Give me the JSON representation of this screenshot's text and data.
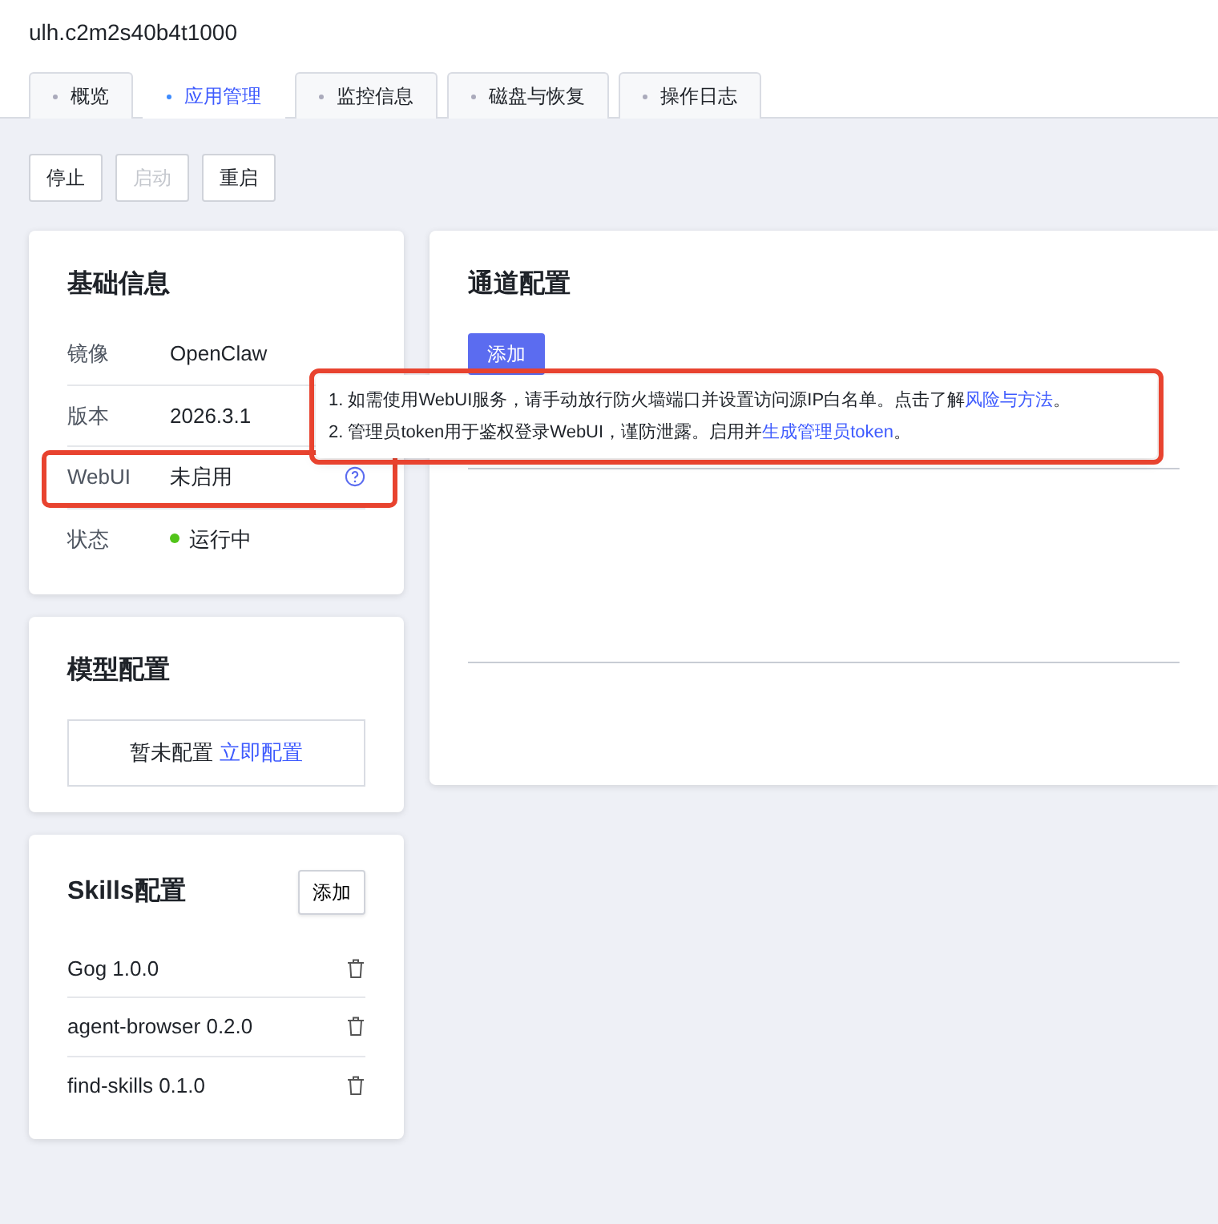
{
  "instance_name": "ulh.c2m2s40b4t1000",
  "tabs": [
    {
      "label": "概览",
      "selected": false
    },
    {
      "label": "应用管理",
      "selected": true
    },
    {
      "label": "监控信息",
      "selected": false
    },
    {
      "label": "磁盘与恢复",
      "selected": false
    },
    {
      "label": "操作日志",
      "selected": false
    }
  ],
  "actions": [
    {
      "label": "停止",
      "disabled": false
    },
    {
      "label": "启动",
      "disabled": true
    },
    {
      "label": "重启",
      "disabled": false
    }
  ],
  "basic_info": {
    "title": "基础信息",
    "rows": [
      {
        "label": "镜像",
        "value": "OpenClaw",
        "kind": "text",
        "highlighted": false
      },
      {
        "label": "版本",
        "value": "2026.3.1",
        "kind": "text",
        "highlighted": false
      },
      {
        "label": "WebUI",
        "value": "未启用",
        "kind": "help",
        "highlighted": true
      },
      {
        "label": "状态",
        "value": "运行中",
        "kind": "status",
        "color": "#52c41a",
        "highlighted": false
      }
    ]
  },
  "model_config": {
    "title": "模型配置",
    "empty_text": "暂未配置",
    "link": "立即配置"
  },
  "skills_config": {
    "title": "Skills配置",
    "add_button": "添加",
    "items": [
      "Gog 1.0.0",
      "agent-browser 0.2.0",
      "find-skills 0.1.0"
    ]
  },
  "channel_config": {
    "title": "通道配置",
    "add_button": "添加"
  },
  "tooltip": {
    "highlighted": true,
    "lines": [
      {
        "before": "1. 如需使用WebUI服务，请手动放行防火墙端口并设置访问源IP白名单。点击了解",
        "link": "风险与方法",
        "after": "。"
      },
      {
        "before": "2. 管理员token用于鉴权登录WebUI，谨防泄露。启用并",
        "link": "生成管理员token",
        "after": "。"
      }
    ]
  }
}
